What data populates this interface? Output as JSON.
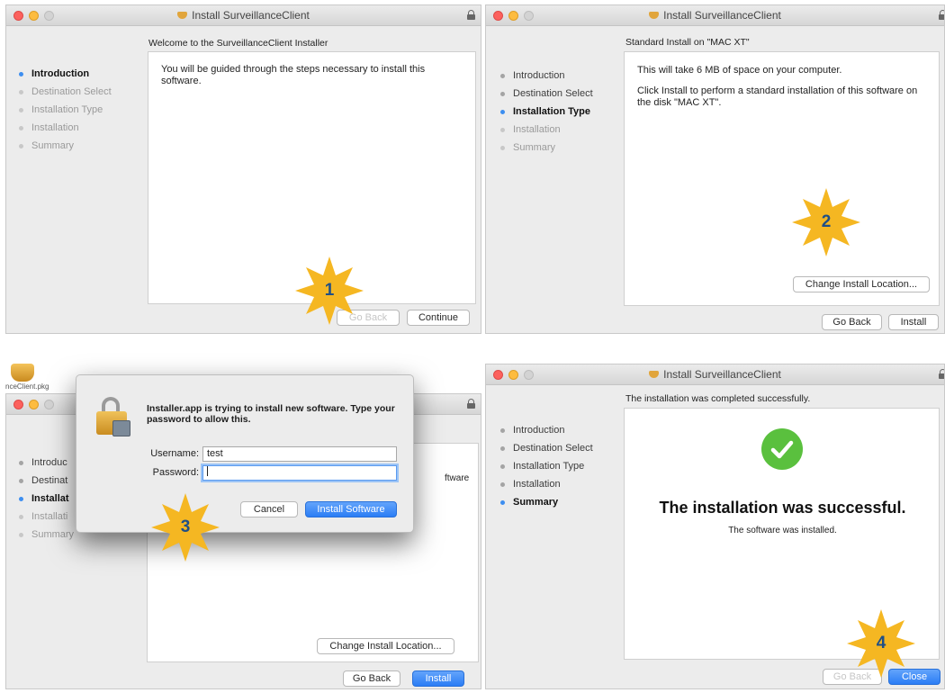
{
  "window_title": "Install SurveillanceClient",
  "steps": [
    "Introduction",
    "Destination Select",
    "Installation Type",
    "Installation",
    "Summary"
  ],
  "steps_cut": [
    "Introduc",
    "Destinat",
    "Installat",
    "Installati",
    "Summary"
  ],
  "panel1": {
    "heading": "Welcome to the SurveillanceClient Installer",
    "body": "You will be guided through the steps necessary to install this software.",
    "back_label": "Go Back",
    "continue_label": "Continue",
    "badge": "1"
  },
  "panel2": {
    "heading": "Standard Install on \"MAC XT\"",
    "line1": "This will take 6 MB of space on your computer.",
    "line2": "Click Install to perform a standard installation of this software on the disk \"MAC XT\".",
    "change_location_label": "Change Install Location...",
    "back_label": "Go Back",
    "install_label": "Install",
    "badge": "2"
  },
  "panel3": {
    "desktop_label": "nceClient.pkg",
    "content_fragment": "ftware",
    "change_location_label": "Change Install Location...",
    "back_label": "Go Back",
    "install_label": "Install",
    "badge": "3",
    "dialog": {
      "message_bold": "Installer.app is trying to install new software. Type your password to allow this.",
      "username_label": "Username:",
      "username_value": "test",
      "password_label": "Password:",
      "password_value": "",
      "cancel_label": "Cancel",
      "install_software_label": "Install Software"
    }
  },
  "panel4": {
    "heading": "The installation was completed successfully.",
    "success_title": "The installation was successful.",
    "success_sub": "The software was installed.",
    "back_label": "Go Back",
    "close_label": "Close",
    "badge": "4"
  },
  "colors": {
    "accent": "#2b7df5",
    "badge": "#f5b722",
    "success": "#5ac03e"
  }
}
